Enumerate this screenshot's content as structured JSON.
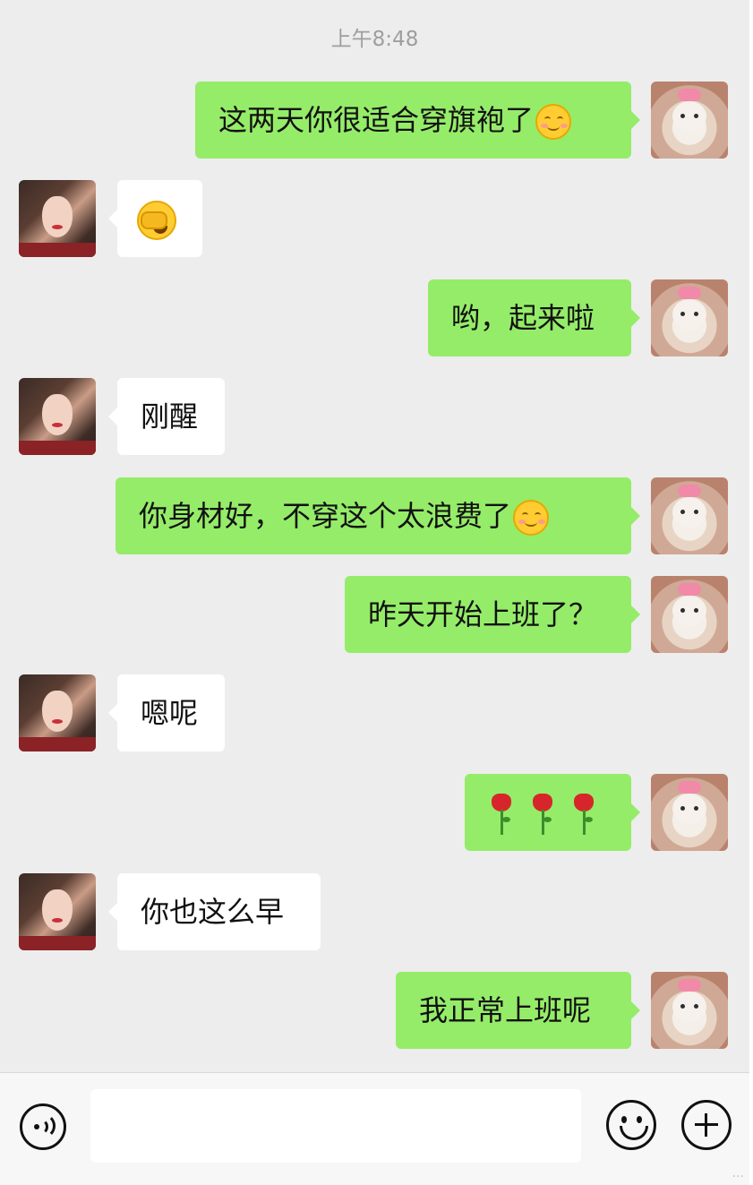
{
  "chat": {
    "timestamp": "上午8:48",
    "messages": [
      {
        "side": "sent",
        "text": "这两天你很适合穿旗袍了",
        "emoji": "smiling-face-icon"
      },
      {
        "side": "recv",
        "text": "",
        "emoji": "facepalm-laughing-icon"
      },
      {
        "side": "sent",
        "text": "哟，起来啦"
      },
      {
        "side": "recv",
        "text": "刚醒"
      },
      {
        "side": "sent",
        "text": "你身材好，不穿这个太浪费了",
        "emoji": "smiling-face-icon"
      },
      {
        "side": "sent",
        "text": "昨天开始上班了？"
      },
      {
        "side": "recv",
        "text": "嗯呢"
      },
      {
        "side": "sent",
        "text": "",
        "emoji": "rose-icon x3"
      },
      {
        "side": "recv",
        "text": "你也这么早"
      },
      {
        "side": "sent",
        "text": "我正常上班呢"
      }
    ]
  },
  "input_bar": {
    "voice_icon": "voice-icon",
    "emoji_icon": "emoji-icon",
    "plus_icon": "plus-icon"
  },
  "watermark": "...",
  "colors": {
    "background": "#ededed",
    "sent_bubble": "#95ec69",
    "received_bubble": "#ffffff",
    "timestamp_text": "#9e9e9e"
  }
}
